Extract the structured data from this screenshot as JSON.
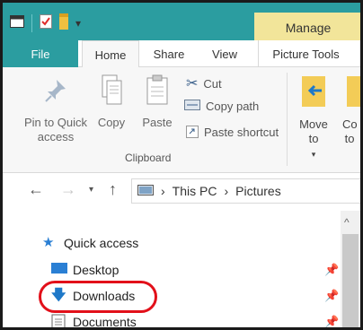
{
  "tabs": {
    "file": "File",
    "home": "Home",
    "share": "Share",
    "view": "View",
    "manage": "Manage",
    "picture_tools": "Picture Tools"
  },
  "ribbon": {
    "pin_quick_access": "Pin to Quick access",
    "copy": "Copy",
    "paste": "Paste",
    "cut": "Cut",
    "copy_path": "Copy path",
    "paste_shortcut": "Paste shortcut",
    "clipboard_group": "Clipboard",
    "move_to": "Move to",
    "copy_to_partial": "Co to"
  },
  "address": {
    "this_pc": "This PC",
    "pictures": "Pictures"
  },
  "nav_pane": {
    "quick_access": "Quick access",
    "desktop": "Desktop",
    "downloads": "Downloads",
    "documents": "Documents"
  },
  "colors": {
    "titlebar": "#2b9da0",
    "manage_tab": "#f2e59a",
    "highlight": "#e2101a"
  }
}
